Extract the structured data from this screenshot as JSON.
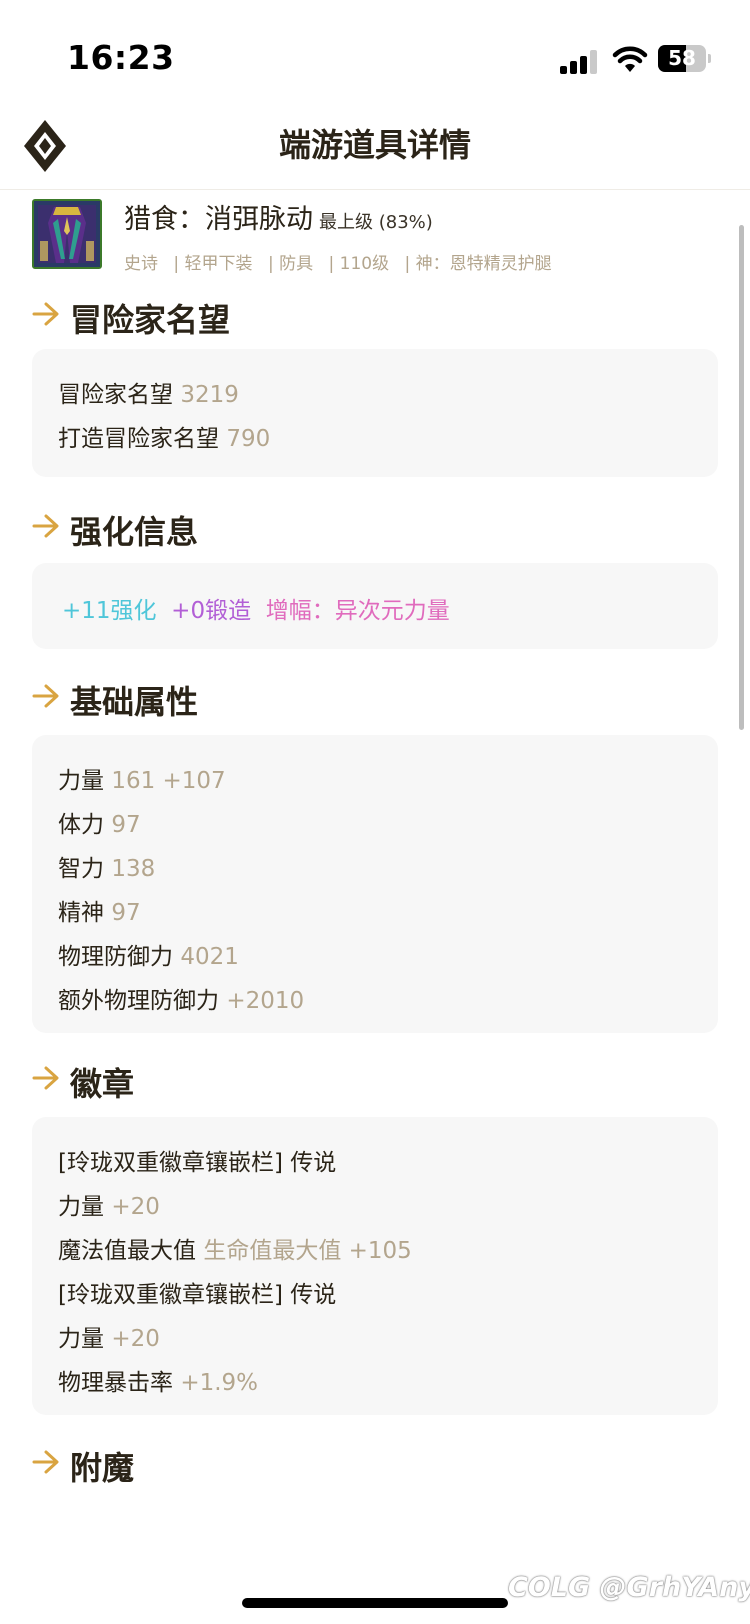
{
  "status": {
    "time": "16:23",
    "battery": "58",
    "battery_level": 0.58
  },
  "nav": {
    "title": "端游道具详情",
    "logo_icon": "diamond-logo-icon"
  },
  "item": {
    "name": "猎食：消弭脉动",
    "grade": "最上级 (83%)",
    "tags": [
      "史诗",
      "| 轻甲下装",
      "| 防具",
      "| 110级",
      "| 神：恩特精灵护腿"
    ],
    "icon": "legging-armor-icon"
  },
  "sections": {
    "fame": {
      "title": "冒险家名望",
      "lines": [
        {
          "label": "冒险家名望",
          "value": "3219"
        },
        {
          "label": "打造冒险家名望",
          "value": "790"
        }
      ]
    },
    "enhance": {
      "title": "强化信息",
      "reinforce": "+11强化",
      "forge": "+0锻造",
      "amplify": "增幅：异次元力量",
      "colors": {
        "reinforce": "#4fc6d9",
        "forge": "#b25fd6",
        "amplify": "#e06bbd"
      }
    },
    "base": {
      "title": "基础属性",
      "lines": [
        {
          "label": "力量",
          "value": "161 +107"
        },
        {
          "label": "体力",
          "value": "97"
        },
        {
          "label": "智力",
          "value": "138"
        },
        {
          "label": "精神",
          "value": "97"
        },
        {
          "label": "物理防御力",
          "value": "4021"
        },
        {
          "label": "额外物理防御力",
          "value": "+2010"
        }
      ]
    },
    "emblem": {
      "title": "徽章",
      "lines": [
        {
          "label": "[玲珑双重徽章镶嵌栏] 传说",
          "value": ""
        },
        {
          "label": "力量",
          "value": "+20"
        },
        {
          "label": "魔法值最大值",
          "value": "生命值最大值 +105"
        },
        {
          "label": "[玲珑双重徽章镶嵌栏] 传说",
          "value": ""
        },
        {
          "label": "力量",
          "value": "+20"
        },
        {
          "label": "物理暴击率",
          "value": "+1.9%"
        }
      ]
    },
    "enchant": {
      "title": "附魔"
    }
  },
  "watermark": "COLG @GrhYAnyu",
  "colors": {
    "accent_gold": "#d9a441",
    "value_text": "#b3a58d",
    "card_bg": "#f7f7f7"
  }
}
